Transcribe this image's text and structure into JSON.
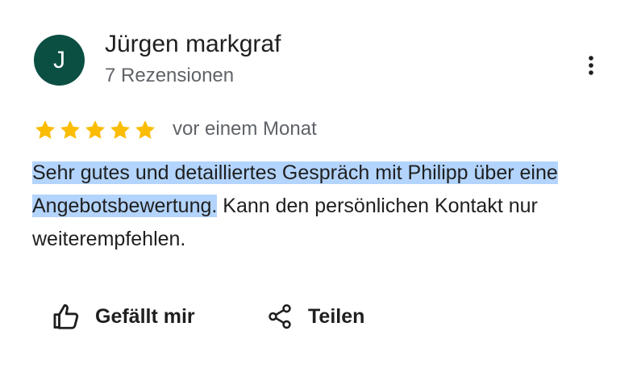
{
  "review": {
    "avatar_initial": "J",
    "avatar_color": "#0b4f43",
    "author_name": "Jürgen markgraf",
    "review_count": "7 Rezensionen",
    "rating": 5,
    "rating_max": 5,
    "star_color": "#fbbc04",
    "date": "vor einem Monat",
    "text_highlighted": "Sehr gutes und detailliertes Gespräch mit Philipp über eine Angebotsbewertung.",
    "text_rest": " Kann den persönlichen Kontakt nur weiterempfehlen.",
    "selection_color": "#b3d4fc"
  },
  "actions": {
    "like_label": "Gefällt mir",
    "like_icon": "thumbs-up-icon",
    "share_label": "Teilen",
    "share_icon": "share-icon",
    "more_icon": "more-vert-icon"
  }
}
